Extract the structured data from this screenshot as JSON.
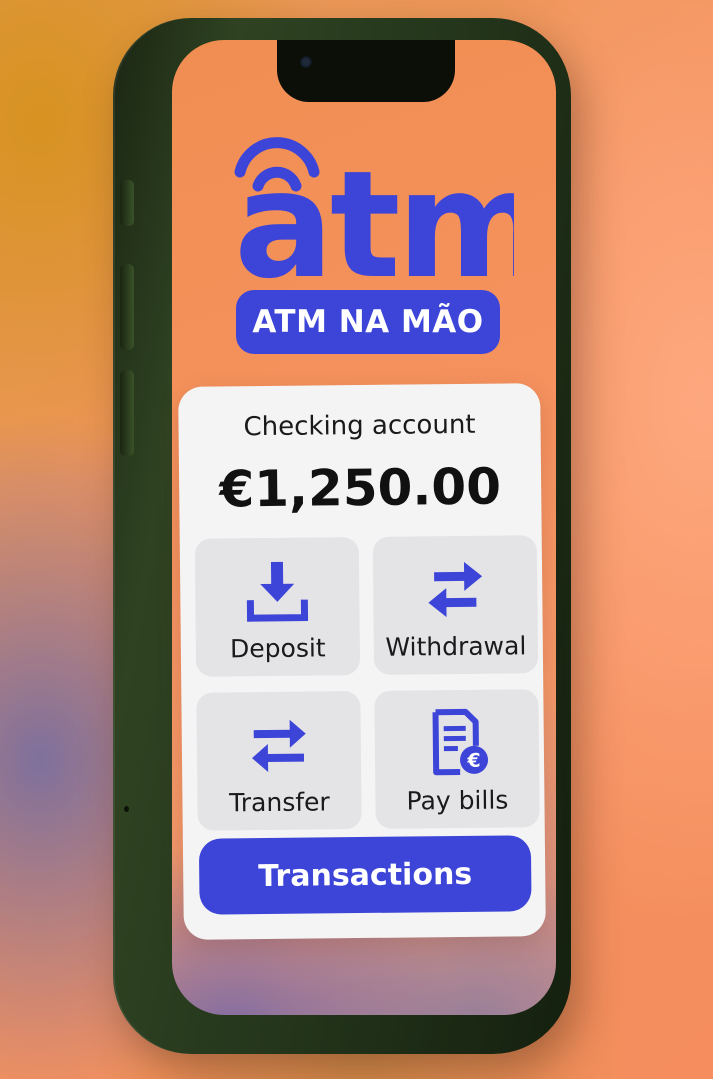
{
  "brand": {
    "logo_text": "atm",
    "pill_text": "ATM NA MÃO",
    "accent_color": "#3d45d8"
  },
  "account": {
    "label": "Checking account",
    "balance": "€1,250.00"
  },
  "actions": [
    {
      "label": "Deposit",
      "icon": "download-icon"
    },
    {
      "label": "Withdrawal",
      "icon": "swap-arrows-icon"
    },
    {
      "label": "Transfer",
      "icon": "transfer-arrows-icon"
    },
    {
      "label": "Pay bills",
      "icon": "bill-euro-icon"
    }
  ],
  "transactions_button": "Transactions"
}
